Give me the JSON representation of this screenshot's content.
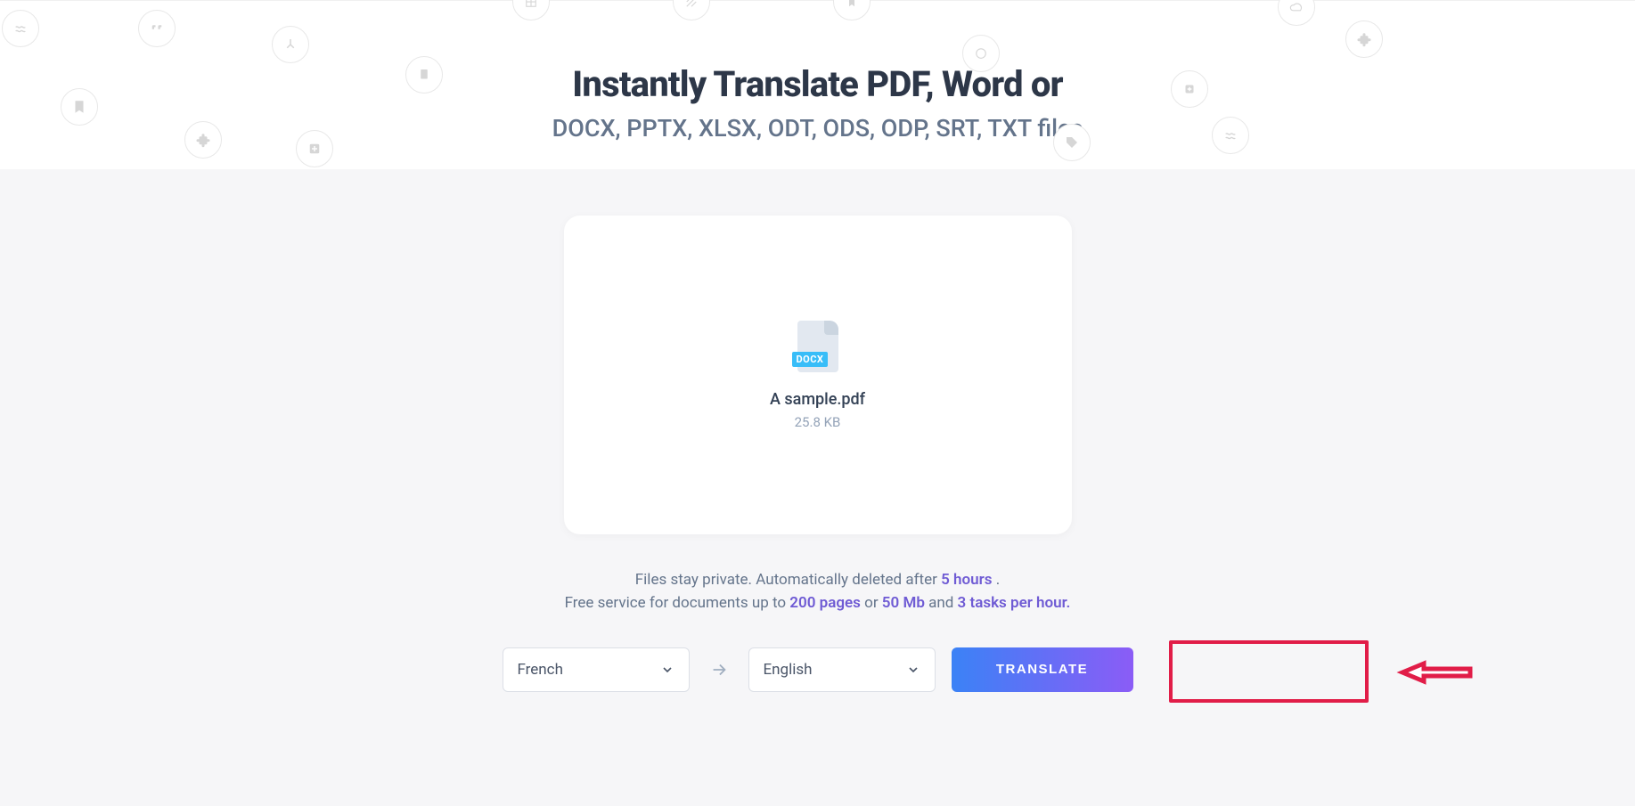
{
  "hero": {
    "title": "Instantly Translate PDF, Word or",
    "subtitle": "DOCX, PPTX, XLSX, ODT, ODS, ODP, SRT, TXT files"
  },
  "card": {
    "file_badge": "DOCX",
    "file_name": "A sample.pdf",
    "file_size": "25.8 KB"
  },
  "info": {
    "line1_prefix": "Files stay private. Automatically deleted after ",
    "line1_highlight": "5 hours",
    "line1_suffix": " .",
    "line2_prefix": "Free service for documents up to ",
    "line2_h1": "200 pages",
    "line2_mid1": " or ",
    "line2_h2": "50 Mb",
    "line2_mid2": " and ",
    "line2_h3": "3 tasks per hour."
  },
  "controls": {
    "from_language": "French",
    "to_language": "English",
    "translate_label": "TRANSLATE"
  }
}
